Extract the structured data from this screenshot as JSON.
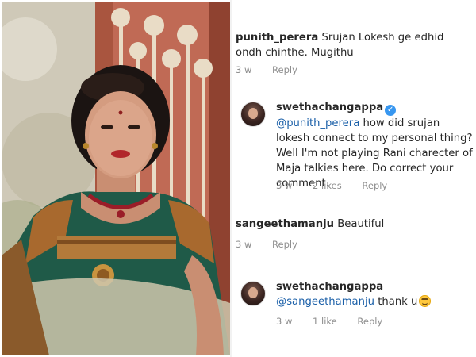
{
  "comments": [
    {
      "username": "punith_perera",
      "text": "Srujan Lokesh ge edhid ondh chinthe. Mugithu",
      "time": "3 w",
      "reply_label": "Reply"
    },
    {
      "username": "swethachangappa",
      "verified": true,
      "mention": "@punith_perera",
      "text": "how did srujan lokesh connect to my personal thing? Well I'm not playing Rani charecter of Maja talkies here. Do correct your comment.",
      "time": "3 w",
      "likes": "2 likes",
      "reply_label": "Reply"
    },
    {
      "username": "sangeethamanju",
      "text": "Beautiful",
      "time": "3 w",
      "reply_label": "Reply"
    },
    {
      "username": "swethachangappa",
      "mention": "@sangeethamanju",
      "text": "thank u",
      "emoji": "smiling-face-icon",
      "time": "3 w",
      "likes": "1 like",
      "reply_label": "Reply"
    }
  ],
  "colors": {
    "username": "#262626",
    "mention": "#1a5fa8",
    "meta": "#8e8e8e",
    "verified": "#3897f0",
    "saree_green": "#1f5a48",
    "border_gold": "#a8692e"
  }
}
